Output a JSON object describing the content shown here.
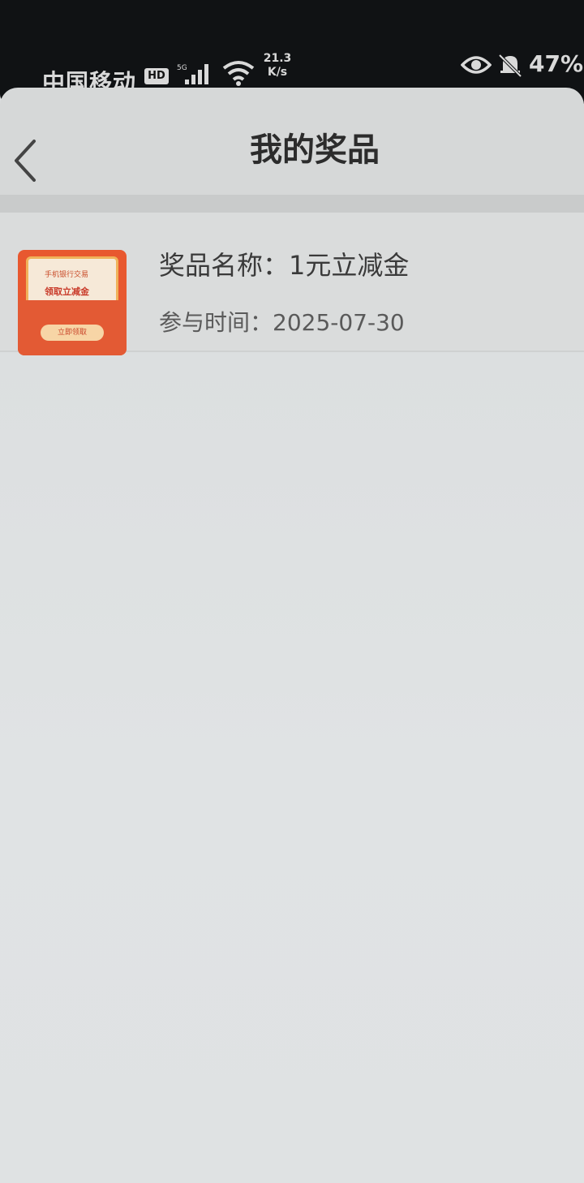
{
  "status_bar": {
    "carrier": "中国移动",
    "hd": "HD",
    "net_speed_value": "21.3",
    "net_speed_unit": "K/s",
    "battery": "47%"
  },
  "nav": {
    "title": "我的奖品"
  },
  "prizes": [
    {
      "name": "奖品名称：1元立减金",
      "time": "参与时间：2025-07-30",
      "thumb_line1": "手机银行交易",
      "thumb_line2": "领取立减金",
      "thumb_button": "立即领取"
    }
  ],
  "colors": {
    "accent": "#e35a34",
    "status_bar_bg": "#101214",
    "page_bg": "#dcdedf"
  }
}
